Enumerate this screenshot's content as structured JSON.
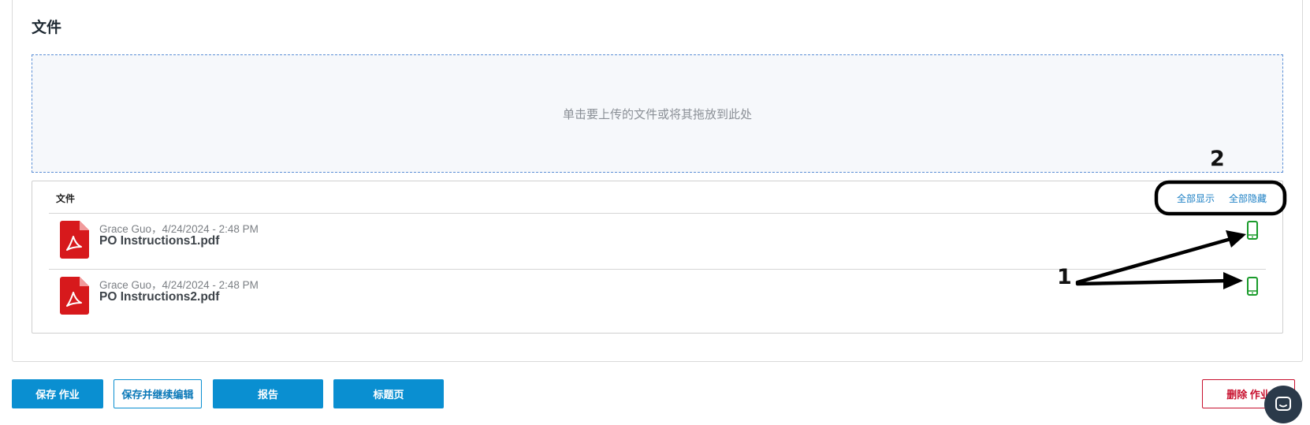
{
  "section": {
    "title": "文件"
  },
  "dropzone": {
    "text": "单击要上传的文件或将其拖放到此处"
  },
  "files_panel": {
    "header_label": "文件",
    "show_all": "全部显示",
    "hide_all": "全部隐藏",
    "files": [
      {
        "meta": "Grace Guo，4/24/2024 - 2:48 PM",
        "name": "PO Instructions1.pdf",
        "icon": "pdf-icon",
        "mobile_icon": "mobile-phone-icon"
      },
      {
        "meta": "Grace Guo，4/24/2024 - 2:48 PM",
        "name": "PO Instructions2.pdf",
        "icon": "pdf-icon",
        "mobile_icon": "mobile-phone-icon"
      }
    ]
  },
  "annotations": {
    "label1": "1",
    "label2": "2"
  },
  "actions": {
    "save": "保存 作业",
    "save_continue": "保存并继续编辑",
    "report": "报告",
    "title_page": "标题页",
    "delete": "删除 作业"
  },
  "colors": {
    "primary": "#0a8fd1",
    "danger": "#c8102e",
    "pdf_red": "#d7191c",
    "mobile_green": "#1a9b2b",
    "link_blue": "#1b7fc4"
  }
}
